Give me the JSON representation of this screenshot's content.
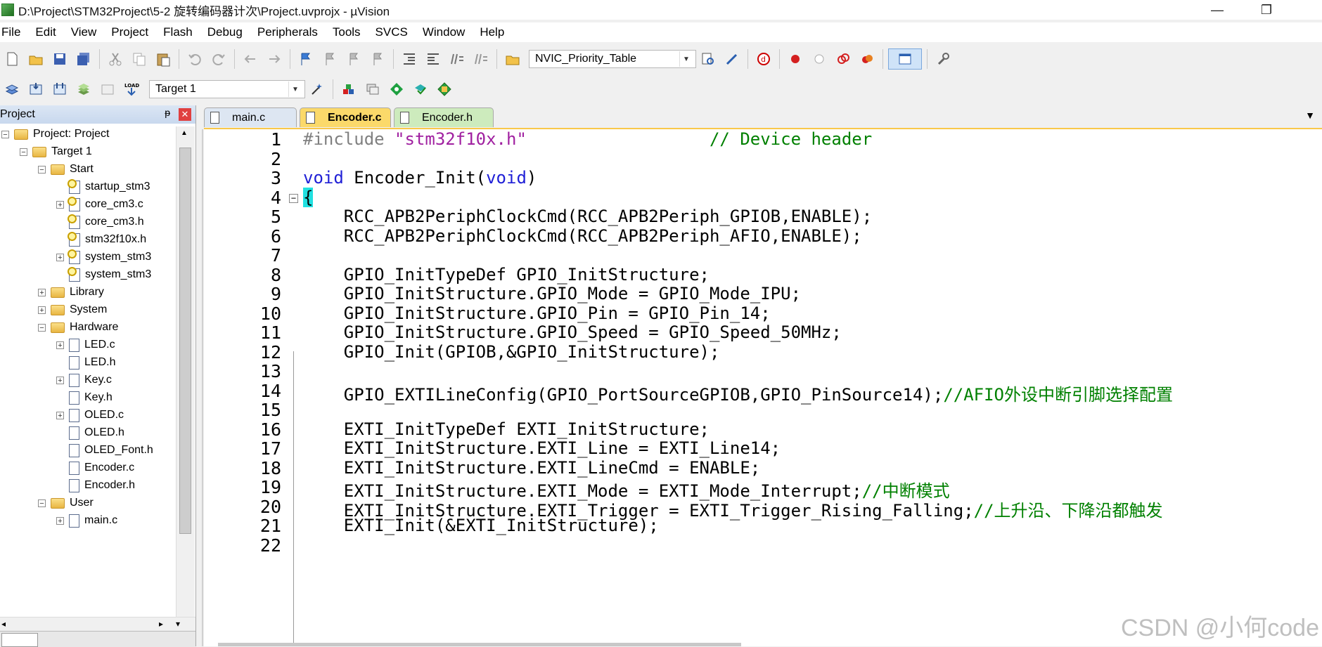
{
  "window": {
    "title": "D:\\Project\\STM32Project\\5-2 旋转编码器计次\\Project.uvprojx - µVision",
    "minimize_glyph": "—",
    "restore_glyph": "❐"
  },
  "menu": [
    "File",
    "Edit",
    "View",
    "Project",
    "Flash",
    "Debug",
    "Peripherals",
    "Tools",
    "SVCS",
    "Window",
    "Help"
  ],
  "toolbar": {
    "function_dropdown": "NVIC_Priority_Table",
    "target_dropdown": "Target 1",
    "load_label": "LOAD"
  },
  "project_panel": {
    "title": "Project",
    "pin_glyph": "ᵽ",
    "close_glyph": "✕",
    "tree": [
      {
        "label": "Project: Project",
        "level": 0,
        "icon": "project",
        "expander": "−"
      },
      {
        "label": "Target 1",
        "level": 1,
        "icon": "target",
        "expander": "−"
      },
      {
        "label": "Start",
        "level": 2,
        "icon": "folder",
        "expander": "−"
      },
      {
        "label": "startup_stm3",
        "level": 3,
        "icon": "keyfile",
        "expander": ""
      },
      {
        "label": "core_cm3.c",
        "level": 3,
        "icon": "keyfile",
        "expander": "+"
      },
      {
        "label": "core_cm3.h",
        "level": 3,
        "icon": "keyfile",
        "expander": ""
      },
      {
        "label": "stm32f10x.h",
        "level": 3,
        "icon": "keyfile",
        "expander": ""
      },
      {
        "label": "system_stm3",
        "level": 3,
        "icon": "keyfile",
        "expander": "+"
      },
      {
        "label": "system_stm3",
        "level": 3,
        "icon": "keyfile",
        "expander": ""
      },
      {
        "label": "Library",
        "level": 2,
        "icon": "folder",
        "expander": "+"
      },
      {
        "label": "System",
        "level": 2,
        "icon": "folder",
        "expander": "+"
      },
      {
        "label": "Hardware",
        "level": 2,
        "icon": "folder",
        "expander": "−"
      },
      {
        "label": "LED.c",
        "level": 3,
        "icon": "file",
        "expander": "+"
      },
      {
        "label": "LED.h",
        "level": 3,
        "icon": "file",
        "expander": ""
      },
      {
        "label": "Key.c",
        "level": 3,
        "icon": "file",
        "expander": "+"
      },
      {
        "label": "Key.h",
        "level": 3,
        "icon": "file",
        "expander": ""
      },
      {
        "label": "OLED.c",
        "level": 3,
        "icon": "file",
        "expander": "+"
      },
      {
        "label": "OLED.h",
        "level": 3,
        "icon": "file",
        "expander": ""
      },
      {
        "label": "OLED_Font.h",
        "level": 3,
        "icon": "file",
        "expander": ""
      },
      {
        "label": "Encoder.c",
        "level": 3,
        "icon": "file",
        "expander": ""
      },
      {
        "label": "Encoder.h",
        "level": 3,
        "icon": "file",
        "expander": ""
      },
      {
        "label": "User",
        "level": 2,
        "icon": "folder",
        "expander": "−"
      },
      {
        "label": "main.c",
        "level": 3,
        "icon": "file",
        "expander": "+"
      }
    ]
  },
  "editor": {
    "tabs": [
      {
        "label": "main.c",
        "state": "inactive"
      },
      {
        "label": "Encoder.c",
        "state": "active"
      },
      {
        "label": "Encoder.h",
        "state": "open"
      }
    ],
    "line_numbers": [
      "1",
      "2",
      "3",
      "4",
      "5",
      "6",
      "7",
      "8",
      "9",
      "10",
      "11",
      "12",
      "13",
      "14",
      "15",
      "16",
      "17",
      "18",
      "19",
      "20",
      "21",
      "22"
    ],
    "lines": [
      [
        {
          "t": "#include ",
          "c": "pp"
        },
        {
          "t": "\"stm32f10x.h\"",
          "c": "str"
        },
        {
          "t": "                  // Device header",
          "c": "cmt"
        }
      ],
      [],
      [
        {
          "t": "void",
          "c": "kw"
        },
        {
          "t": " Encoder_Init(",
          "c": ""
        },
        {
          "t": "void",
          "c": "kw"
        },
        {
          "t": ")",
          "c": ""
        }
      ],
      [
        {
          "t": "{",
          "c": "brace"
        }
      ],
      [
        {
          "t": "    RCC_APB2PeriphClockCmd(RCC_APB2Periph_GPIOB,ENABLE);",
          "c": ""
        }
      ],
      [
        {
          "t": "    RCC_APB2PeriphClockCmd(RCC_APB2Periph_AFIO,ENABLE);",
          "c": ""
        }
      ],
      [],
      [
        {
          "t": "    GPIO_InitTypeDef GPIO_InitStructure;",
          "c": ""
        }
      ],
      [
        {
          "t": "    GPIO_InitStructure.GPIO_Mode = GPIO_Mode_IPU;",
          "c": ""
        }
      ],
      [
        {
          "t": "    GPIO_InitStructure.GPIO_Pin = GPIO_Pin_14;",
          "c": ""
        }
      ],
      [
        {
          "t": "    GPIO_InitStructure.GPIO_Speed = GPIO_Speed_50MHz;",
          "c": ""
        }
      ],
      [
        {
          "t": "    GPIO_Init(GPIOB,&GPIO_InitStructure);",
          "c": ""
        }
      ],
      [],
      [
        {
          "t": "    GPIO_EXTILineConfig(GPIO_PortSourceGPIOB,GPIO_PinSource14);",
          "c": ""
        },
        {
          "t": "//AFIO外设中断引脚选择配置",
          "c": "cmt"
        }
      ],
      [],
      [
        {
          "t": "    EXTI_InitTypeDef EXTI_InitStructure;",
          "c": ""
        }
      ],
      [
        {
          "t": "    EXTI_InitStructure.EXTI_Line = EXTI_Line14;",
          "c": ""
        }
      ],
      [
        {
          "t": "    EXTI_InitStructure.EXTI_LineCmd = ENABLE;",
          "c": ""
        }
      ],
      [
        {
          "t": "    EXTI_InitStructure.EXTI_Mode = EXTI_Mode_Interrupt;",
          "c": ""
        },
        {
          "t": "//中断模式",
          "c": "cmt"
        }
      ],
      [
        {
          "t": "    EXTI_InitStructure.EXTI_Trigger = EXTI_Trigger_Rising_Falling;",
          "c": ""
        },
        {
          "t": "//上升沿、下降沿都触发",
          "c": "cmt"
        }
      ],
      [
        {
          "t": "    EXTI_Init(&EXTI_InitStructure);",
          "c": ""
        }
      ],
      []
    ]
  },
  "watermark": "CSDN @小何code"
}
